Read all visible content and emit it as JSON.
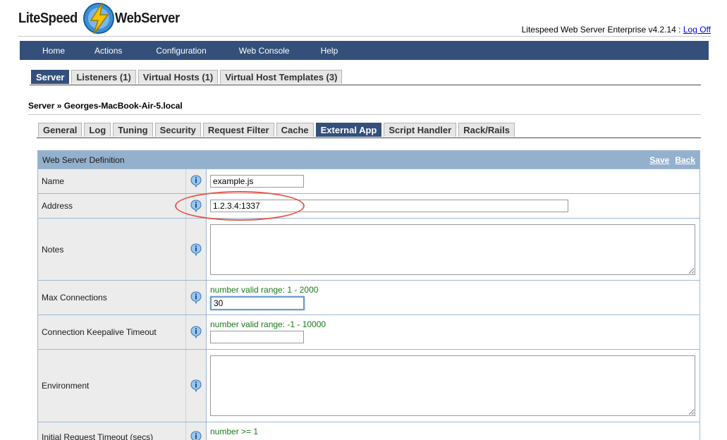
{
  "logo": {
    "left": "LiteSpeed",
    "right": "WebServer"
  },
  "header": {
    "version": "Litespeed Web Server Enterprise v4.2.14 : ",
    "logoff": "Log Off"
  },
  "mainnav": [
    "Home",
    "Actions",
    "Configuration",
    "Web Console",
    "Help"
  ],
  "tabs": [
    "Server",
    "Listeners (1)",
    "Virtual Hosts (1)",
    "Virtual Host Templates (3)"
  ],
  "active_tab": "Server",
  "breadcrumb": "Server » Georges-MacBook-Air-5.local",
  "subtabs": [
    "General",
    "Log",
    "Tuning",
    "Security",
    "Request Filter",
    "Cache",
    "External App",
    "Script Handler",
    "Rack/Rails"
  ],
  "active_subtab": "External App",
  "panel": {
    "title": "Web Server Definition",
    "save": "Save",
    "back": "Back"
  },
  "fields": {
    "name": {
      "label": "Name",
      "value": "example.js"
    },
    "address": {
      "label": "Address",
      "value": "1.2.3.4:1337"
    },
    "notes": {
      "label": "Notes",
      "value": ""
    },
    "max_conn": {
      "label": "Max Connections",
      "hint": "number valid range: 1 - 2000",
      "value": "30"
    },
    "keepalive": {
      "label": "Connection Keepalive Timeout",
      "hint": "number valid range: -1 - 10000",
      "value": ""
    },
    "environment": {
      "label": "Environment",
      "value": ""
    },
    "initial_timeout": {
      "label": "Initial Request Timeout (secs)",
      "hint": "number >= 1"
    }
  },
  "colors": {
    "nav": "#34507a",
    "panel_head": "#93b1cd",
    "hint": "#1a7a1a",
    "highlight": "#e05a4c"
  }
}
